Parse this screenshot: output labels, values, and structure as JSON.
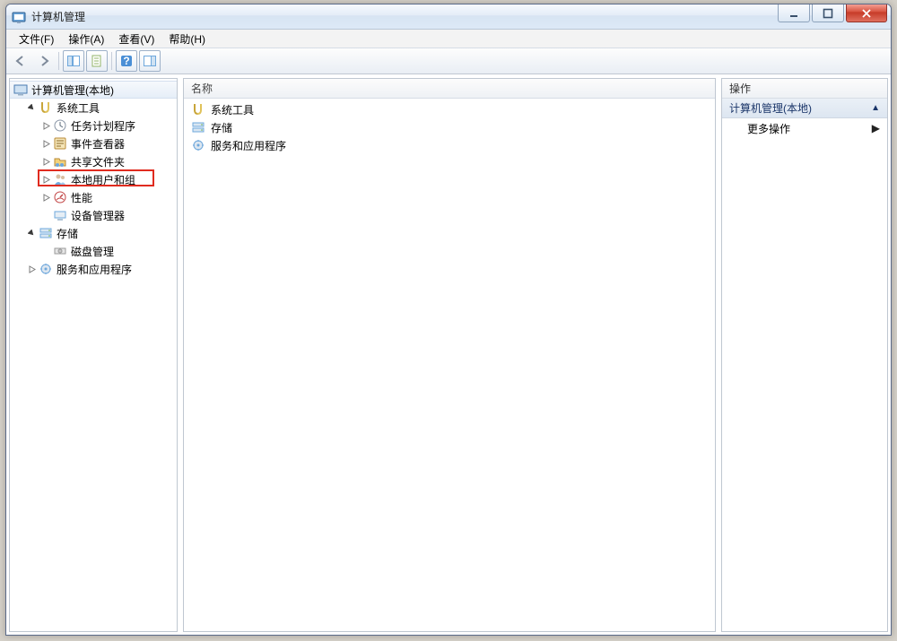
{
  "window": {
    "title": "计算机管理"
  },
  "menu": {
    "file": "文件(F)",
    "action": "操作(A)",
    "view": "查看(V)",
    "help": "帮助(H)"
  },
  "tree": {
    "root": "计算机管理(本地)",
    "system_tools": "系统工具",
    "task_scheduler": "任务计划程序",
    "event_viewer": "事件查看器",
    "shared_folders": "共享文件夹",
    "local_users": "本地用户和组",
    "performance": "性能",
    "device_manager": "设备管理器",
    "storage": "存储",
    "disk_mgmt": "磁盘管理",
    "services_apps": "服务和应用程序"
  },
  "list": {
    "header_name": "名称",
    "items": {
      "system_tools": "系统工具",
      "storage": "存储",
      "services_apps": "服务和应用程序"
    }
  },
  "actions": {
    "header": "操作",
    "group": "计算机管理(本地)",
    "more": "更多操作"
  }
}
